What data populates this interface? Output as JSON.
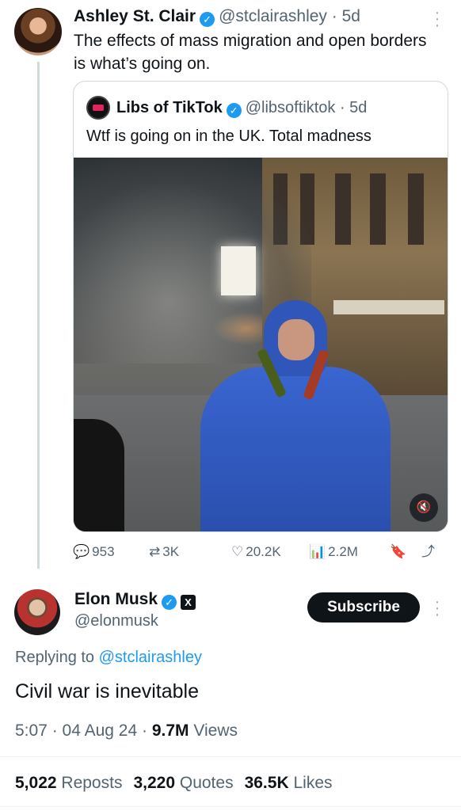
{
  "parent_tweet": {
    "display_name": "Ashley St. Clair",
    "handle": "@stclairashley",
    "time": "5d",
    "text": "The effects of mass migration and open borders is what’s going on."
  },
  "quoted_tweet": {
    "display_name": "Libs of TikTok",
    "handle": "@libsoftiktok",
    "time": "5d",
    "text": "Wtf is going on in the UK. Total madness"
  },
  "actions": {
    "replies": "953",
    "reposts": "3K",
    "likes": "20.2K",
    "views": "2.2M"
  },
  "main_tweet": {
    "display_name": "Elon Musk",
    "handle": "@elonmusk",
    "subscribe_label": "Subscribe",
    "replying_prefix": "Replying to",
    "replying_to": "@stclairashley",
    "text": "Civil war is inevitable",
    "time": "5:07",
    "date": "04 Aug 24",
    "views_count": "9.7M",
    "views_label": "Views"
  },
  "stats": {
    "reposts_count": "5,022",
    "reposts_label": "Reposts",
    "quotes_count": "3,220",
    "quotes_label": "Quotes",
    "likes_count": "36.5K",
    "likes_label": "Likes"
  },
  "icons": {
    "verified": "verified-badge-icon",
    "more": "more-vertical-icon",
    "reply": "reply-icon",
    "repost": "repost-icon",
    "like": "heart-icon",
    "views": "views-icon",
    "bookmark": "bookmark-icon",
    "share": "share-icon",
    "mute": "mute-icon",
    "x_affiliation": "x-logo-icon"
  },
  "colors": {
    "accent": "#1d9bf0",
    "text_primary": "#0f1419",
    "text_secondary": "#536471",
    "button_dark": "#0f1419"
  }
}
